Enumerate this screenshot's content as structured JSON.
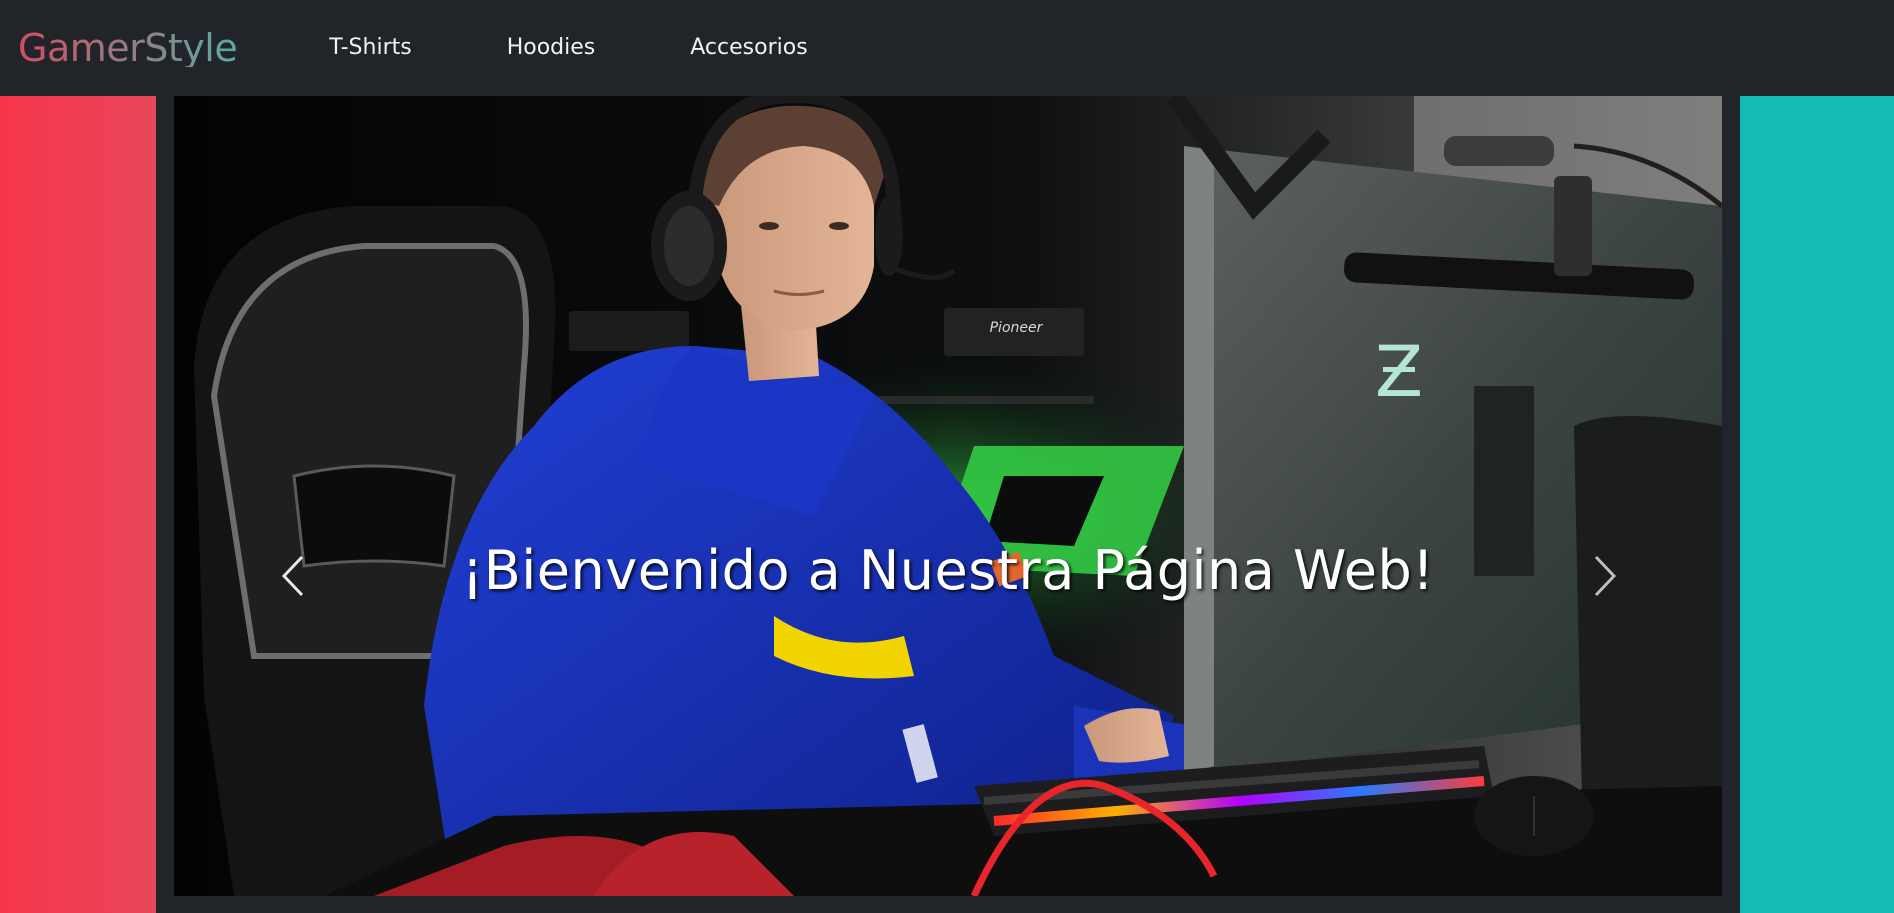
{
  "navbar": {
    "brand": "GamerStyle",
    "links": [
      {
        "label": "T-Shirts"
      },
      {
        "label": "Hoodies"
      },
      {
        "label": "Accesorios"
      }
    ]
  },
  "carousel": {
    "caption": "¡Bienvenido a Nuestra Página Web!",
    "prev_icon": "chevron-left-icon",
    "next_icon": "chevron-right-icon",
    "image_text": {
      "speaker_brand": "Pioneer",
      "monitor_logo": "Ƶ"
    }
  },
  "colors": {
    "navbar_bg": "#212529",
    "left_panel": "#f7364a",
    "right_panel": "#12bcb4",
    "hoodie_blue": "#1a33b8",
    "accent_green": "#39d64a"
  }
}
